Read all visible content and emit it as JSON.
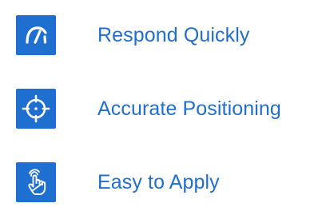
{
  "colors": {
    "accent": "#1e6fd0",
    "icon_fg": "#ffffff",
    "text": "#1e6fd0"
  },
  "features": [
    {
      "icon": "speedometer-icon",
      "label": "Respond Quickly"
    },
    {
      "icon": "crosshair-icon",
      "label": "Accurate Positioning"
    },
    {
      "icon": "tap-hand-icon",
      "label": "Easy to Apply"
    }
  ]
}
